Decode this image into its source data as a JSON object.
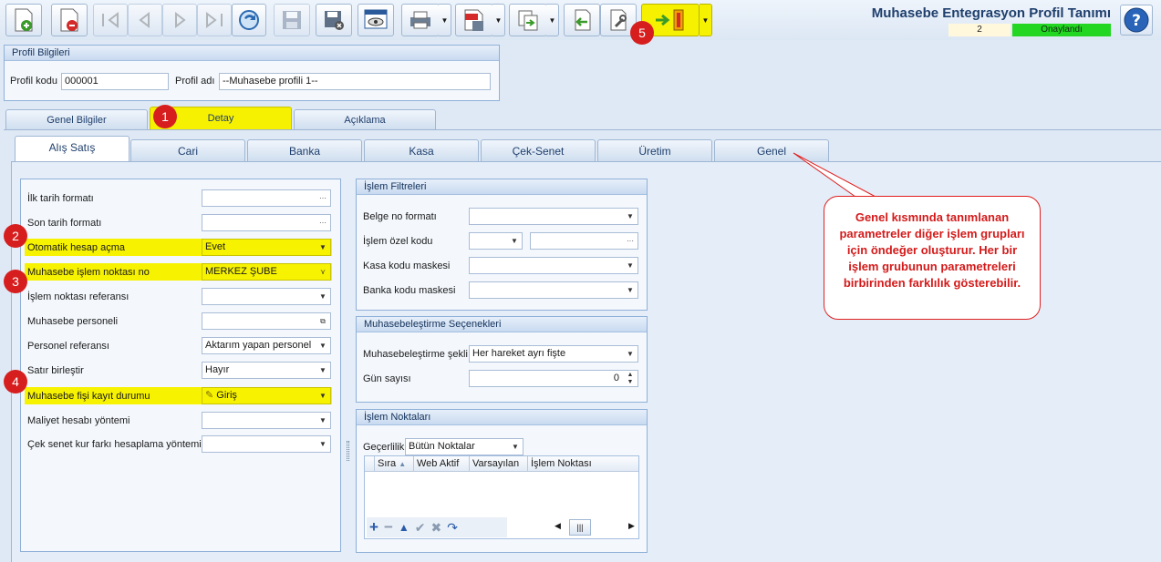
{
  "window": {
    "title": "Muhasebe Entegrasyon Profil Tanımı",
    "record_number": "2",
    "record_status": "Onaylandı",
    "colors": {
      "status_green": "#22d622",
      "highlight_yellow": "#f7f200",
      "badge_red": "#d71e1e"
    }
  },
  "toolbar": {
    "buttons": [
      "new-record-icon",
      "delete-record-icon",
      "first-record-icon",
      "prev-record-icon",
      "next-record-icon",
      "last-record-icon",
      "refresh-icon",
      "save-icon",
      "save-close-icon",
      "preview-icon",
      "print-icon",
      "pdf-export-icon",
      "copy-icon",
      "back-icon",
      "tools-icon",
      "integration-transfer-icon",
      "help-icon"
    ]
  },
  "profile": {
    "group_title": "Profil Bilgileri",
    "code_label": "Profil kodu",
    "code_value": "000001",
    "name_label": "Profil adı",
    "name_value": "--Muhasebe profili 1--"
  },
  "main_tabs": [
    {
      "label": "Genel Bilgiler"
    },
    {
      "label": "Detay"
    },
    {
      "label": "Açıklama"
    }
  ],
  "sub_tabs": [
    {
      "label": "Alış Satış"
    },
    {
      "label": "Cari"
    },
    {
      "label": "Banka"
    },
    {
      "label": "Kasa"
    },
    {
      "label": "Çek-Senet"
    },
    {
      "label": "Üretim"
    },
    {
      "label": "Genel"
    }
  ],
  "left_panel": {
    "fields": [
      {
        "label": "İlk tarih formatı",
        "value": ""
      },
      {
        "label": "Son tarih formatı",
        "value": ""
      },
      {
        "label": "Otomatik hesap açma",
        "value": "Evet"
      },
      {
        "label": "Muhasebe işlem noktası no",
        "value": "MERKEZ ŞUBE"
      },
      {
        "label": "İşlem noktası referansı",
        "value": ""
      },
      {
        "label": "Muhasebe personeli",
        "value": ""
      },
      {
        "label": "Personel referansı",
        "value": "Aktarım yapan personel"
      },
      {
        "label": "Satır birleştir",
        "value": "Hayır"
      },
      {
        "label": "Muhasebe fişi kayıt durumu",
        "value": "Giriş"
      },
      {
        "label": "Maliyet hesabı yöntemi",
        "value": ""
      },
      {
        "label": "Çek senet kur farkı hesaplama yöntemi",
        "value": ""
      }
    ]
  },
  "filters": {
    "title": "İşlem Filtreleri",
    "fields": [
      {
        "label": "Belge no formatı",
        "value": ""
      },
      {
        "label": "İşlem özel kodu",
        "value": ""
      },
      {
        "label": "Kasa kodu maskesi",
        "value": ""
      },
      {
        "label": "Banka kodu maskesi",
        "value": ""
      }
    ]
  },
  "accounting_options": {
    "title": "Muhasebeleştirme Seçenekleri",
    "method_label": "Muhasebeleştirme şekli",
    "method_value": "Her hareket ayrı fişte",
    "days_label": "Gün sayısı",
    "days_value": "0"
  },
  "points": {
    "title": "İşlem Noktaları",
    "validity_label": "Geçerlilik",
    "validity_value": "Bütün Noktalar",
    "columns": [
      "Sıra",
      "Web Aktif",
      "Varsayılan",
      "İşlem Noktası"
    ]
  },
  "callout": {
    "text": "Genel kısmında tanımlanan parametreler diğer işlem grupları için öndeğer oluşturur. Her bir işlem grubunun parametreleri birbirinden farklılık gösterebilir."
  },
  "badges": [
    "1",
    "2",
    "3",
    "4",
    "5"
  ]
}
